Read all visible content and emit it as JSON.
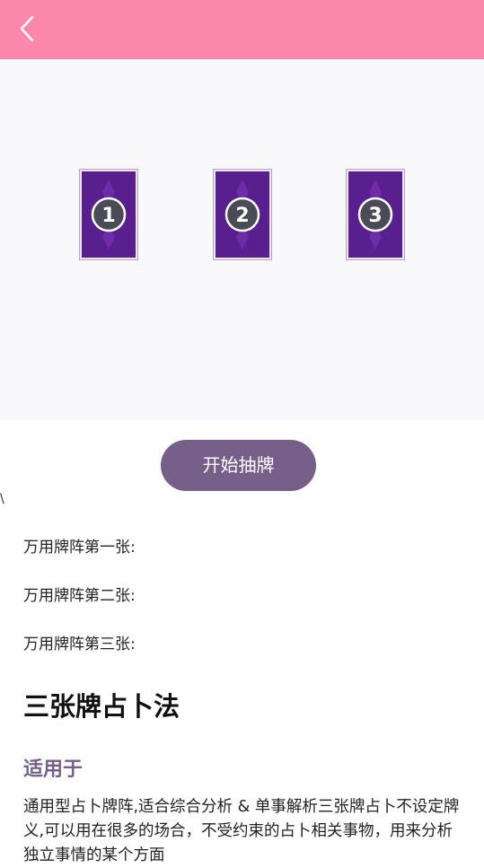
{
  "header": {
    "back_icon": "back-arrow-icon",
    "bg_color": "#fb87ac"
  },
  "cards": [
    {
      "number": "1"
    },
    {
      "number": "2"
    },
    {
      "number": "3"
    }
  ],
  "draw_button": {
    "label": "开始抽牌",
    "color": "#76608a"
  },
  "stray_mark": "\\",
  "positions": [
    {
      "label": "万用牌阵第一张:"
    },
    {
      "label": "万用牌阵第二张:"
    },
    {
      "label": "万用牌阵第三张:"
    }
  ],
  "title": "三张牌占卜法",
  "subtitle": "适用于",
  "description": "通用型占卜牌阵,适合综合分析 & 单事解析三张牌占卜不设定牌义,可以用在很多的场合，不受约束的占卜相关事物，用来分析独立事情的某个方面"
}
